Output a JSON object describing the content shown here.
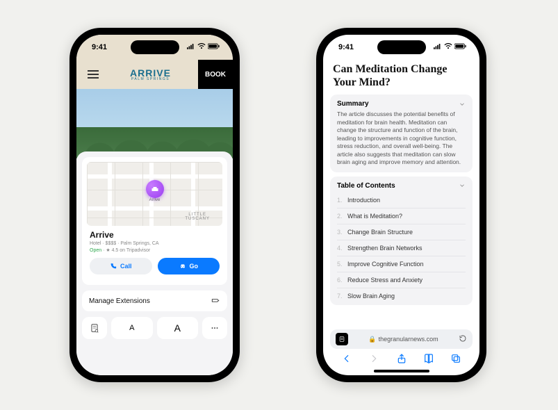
{
  "status": {
    "time": "9:41"
  },
  "left": {
    "logo": {
      "main": "ARRIVE",
      "sub": "PALM SPRINGS"
    },
    "book": "BOOK",
    "map": {
      "pinLabel": "Arrive",
      "areaLine1": "LITTLE",
      "areaLine2": "TUSCANY"
    },
    "place": {
      "name": "Arrive",
      "meta": "Hotel · $$$$ · Palm Springs, CA",
      "open": "Open",
      "rating": "★ 4.5 on Tripadvisor"
    },
    "actions": {
      "call": "Call",
      "go": "Go"
    },
    "extensions": "Manage Extensions",
    "fontSmall": "A",
    "fontLarge": "A"
  },
  "right": {
    "title": "Can Meditation Change Your Mind?",
    "summary": {
      "heading": "Summary",
      "body": "The article discusses the potential benefits of meditation for brain health. Meditation can change the structure and function of the brain, leading to improvements in cognitive function, stress reduction, and overall well-being. The article also suggests that meditation can slow brain aging and improve memory and attention."
    },
    "toc": {
      "heading": "Table of Contents",
      "items": [
        {
          "n": "1.",
          "t": "Introduction"
        },
        {
          "n": "2.",
          "t": "What is Meditation?"
        },
        {
          "n": "3.",
          "t": "Change Brain Structure"
        },
        {
          "n": "4.",
          "t": "Strengthen Brain Networks"
        },
        {
          "n": "5.",
          "t": "Improve Cognitive Function"
        },
        {
          "n": "6.",
          "t": "Reduce Stress and Anxiety"
        },
        {
          "n": "7.",
          "t": "Slow Brain Aging"
        }
      ]
    },
    "url": "thegranularnews.com"
  }
}
